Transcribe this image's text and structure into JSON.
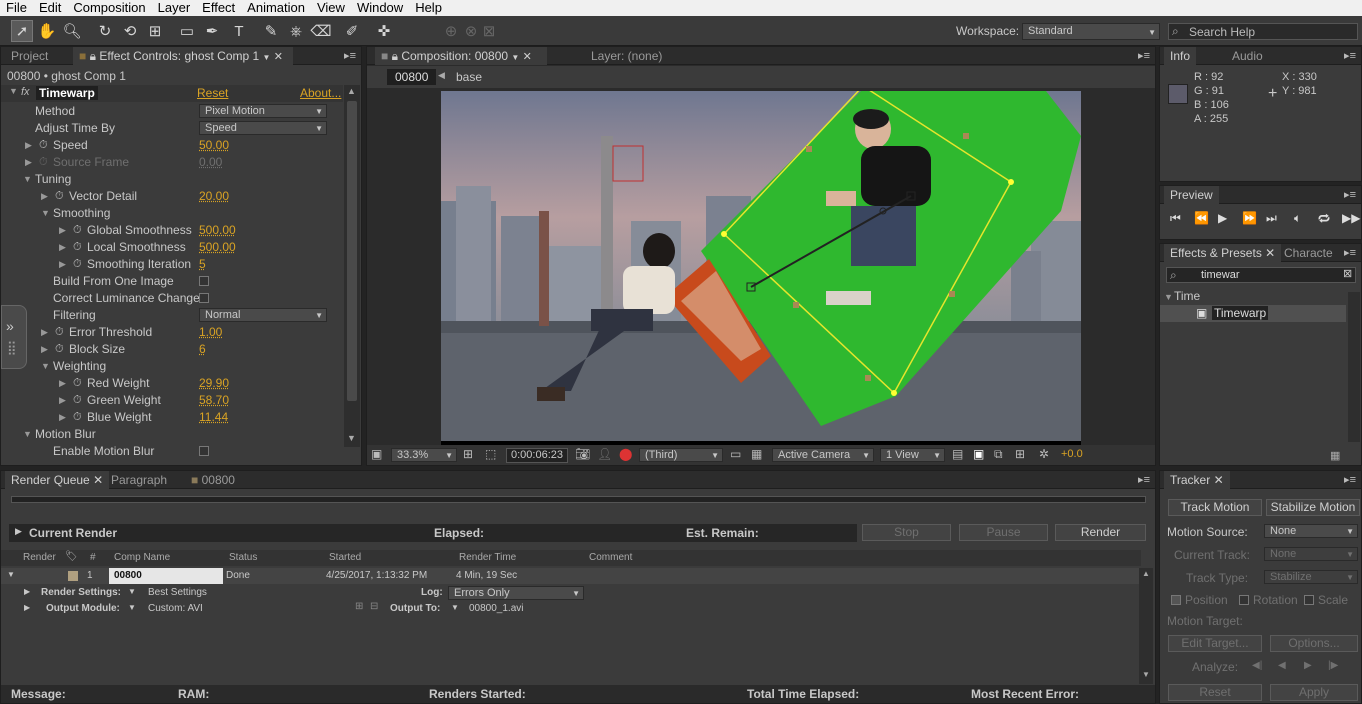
{
  "menu": [
    "File",
    "Edit",
    "Composition",
    "Layer",
    "Effect",
    "Animation",
    "View",
    "Window",
    "Help"
  ],
  "toolbar": {
    "workspace_label": "Workspace:",
    "workspace_value": "Standard",
    "search_placeholder": "Search Help"
  },
  "effect_controls": {
    "tab_project": "Project",
    "tab_title": "Effect Controls: ghost Comp 1",
    "layer_label": "00800 • ghost Comp 1",
    "effect_name": "Timewarp",
    "reset": "Reset",
    "about": "About...",
    "rows": [
      {
        "label": "Method",
        "value": "Pixel Motion",
        "kind": "dropdown"
      },
      {
        "label": "Adjust Time By",
        "value": "Speed",
        "kind": "dropdown"
      },
      {
        "label": "Speed",
        "value": "50.00",
        "kind": "num"
      },
      {
        "label": "Source Frame",
        "value": "0.00",
        "kind": "numdim"
      },
      {
        "label": "Tuning",
        "value": "",
        "kind": "group"
      },
      {
        "label": "Vector Detail",
        "value": "20.00",
        "kind": "num"
      },
      {
        "label": "Smoothing",
        "value": "",
        "kind": "group"
      },
      {
        "label": "Global Smoothness",
        "value": "500.00",
        "kind": "num"
      },
      {
        "label": "Local Smoothness",
        "value": "500.00",
        "kind": "num"
      },
      {
        "label": "Smoothing Iteration",
        "value": "5",
        "kind": "num"
      },
      {
        "label": "Build From One Image",
        "value": "",
        "kind": "check"
      },
      {
        "label": "Correct Luminance Changes",
        "value": "",
        "kind": "check"
      },
      {
        "label": "Filtering",
        "value": "Normal",
        "kind": "dropdown"
      },
      {
        "label": "Error Threshold",
        "value": "1.00",
        "kind": "num"
      },
      {
        "label": "Block Size",
        "value": "6",
        "kind": "num"
      },
      {
        "label": "Weighting",
        "value": "",
        "kind": "group"
      },
      {
        "label": "Red Weight",
        "value": "29.90",
        "kind": "num"
      },
      {
        "label": "Green Weight",
        "value": "58.70",
        "kind": "num"
      },
      {
        "label": "Blue Weight",
        "value": "11.44",
        "kind": "num"
      },
      {
        "label": "Motion Blur",
        "value": "",
        "kind": "group"
      },
      {
        "label": "Enable Motion Blur",
        "value": "",
        "kind": "check"
      }
    ]
  },
  "composition": {
    "tab": "Composition: 00800",
    "layer_tab": "Layer: (none)",
    "crumb_comp": "00800",
    "crumb_base": "base",
    "zoom": "33.3%",
    "timecode": "0:00:06:23",
    "resolution": "(Third)",
    "camera": "Active Camera",
    "views": "1 View",
    "exposure": "+0.0"
  },
  "info": {
    "tab": "Info",
    "tab2": "Audio",
    "r": "R : 92",
    "g": "G : 91",
    "b": "B : 106",
    "a": "A : 255",
    "x": "X : 330",
    "y": "Y : 981",
    "swatch": "#5c5b6a"
  },
  "preview": {
    "tab": "Preview"
  },
  "effects_presets": {
    "tab": "Effects & Presets",
    "tab2": "Characte",
    "search": "timewar",
    "category": "Time",
    "item": "Timewarp"
  },
  "render_queue": {
    "tabs": [
      "Render Queue",
      "Paragraph",
      "00800"
    ],
    "current_render": "Current Render",
    "elapsed": "Elapsed:",
    "est_remain": "Est. Remain:",
    "stop": "Stop",
    "pause": "Pause",
    "render": "Render",
    "headers": [
      "Render",
      "#",
      "Comp Name",
      "Status",
      "Started",
      "Render Time",
      "Comment"
    ],
    "item": {
      "num": "1",
      "comp": "00800",
      "status": "Done",
      "started": "4/25/2017, 1:13:32 PM",
      "render_time": "4 Min, 19 Sec"
    },
    "render_settings_label": "Render Settings:",
    "render_settings_value": "Best Settings",
    "log_label": "Log:",
    "log_value": "Errors Only",
    "output_module_label": "Output Module:",
    "output_module_value": "Custom: AVI",
    "output_to_label": "Output To:",
    "output_to_value": "00800_1.avi",
    "status": {
      "message": "Message:",
      "ram": "RAM:",
      "renders_started": "Renders Started:",
      "total_time": "Total Time Elapsed:",
      "recent_error": "Most Recent Error:"
    }
  },
  "tracker": {
    "tab": "Tracker",
    "track_motion": "Track Motion",
    "stabilize_motion": "Stabilize Motion",
    "motion_source_label": "Motion Source:",
    "motion_source_value": "None",
    "current_track_label": "Current Track:",
    "current_track_value": "None",
    "track_type_label": "Track Type:",
    "track_type_value": "Stabilize",
    "position": "Position",
    "rotation": "Rotation",
    "scale": "Scale",
    "motion_target": "Motion Target:",
    "edit_target": "Edit Target...",
    "options": "Options...",
    "analyze": "Analyze:",
    "reset": "Reset",
    "apply": "Apply"
  }
}
